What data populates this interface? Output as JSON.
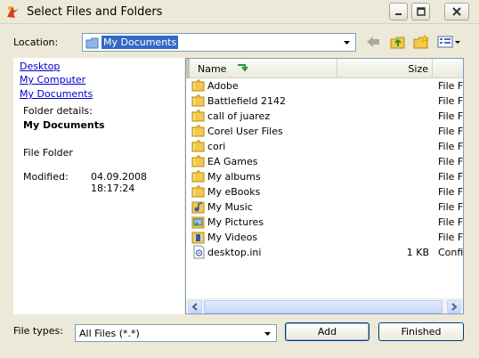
{
  "window": {
    "title": "Select Files and Folders"
  },
  "location": {
    "label": "Location:",
    "value": "My Documents"
  },
  "left_panel": {
    "links": [
      "Desktop",
      "My Computer",
      "My Documents"
    ],
    "details_heading": "Folder details:",
    "folder_name": "My Documents",
    "folder_type": "File Folder",
    "modified_label": "Modified:",
    "modified_date": "04.09.2008",
    "modified_time": "18:17:24"
  },
  "file_list": {
    "columns": {
      "name": "Name",
      "size": "Size"
    },
    "rows": [
      {
        "name": "Adobe",
        "size": "",
        "type": "File Folder",
        "icon": "folder"
      },
      {
        "name": "Battlefield 2142",
        "size": "",
        "type": "File Folder",
        "icon": "folder"
      },
      {
        "name": "call of juarez",
        "size": "",
        "type": "File Folder",
        "icon": "folder"
      },
      {
        "name": "Corel User Files",
        "size": "",
        "type": "File Folder",
        "icon": "folder"
      },
      {
        "name": "cori",
        "size": "",
        "type": "File Folder",
        "icon": "folder"
      },
      {
        "name": "EA Games",
        "size": "",
        "type": "File Folder",
        "icon": "folder"
      },
      {
        "name": "My albums",
        "size": "",
        "type": "File Folder",
        "icon": "folder"
      },
      {
        "name": "My eBooks",
        "size": "",
        "type": "File Folder",
        "icon": "folder"
      },
      {
        "name": "My Music",
        "size": "",
        "type": "File Folder",
        "icon": "music-folder"
      },
      {
        "name": "My Pictures",
        "size": "",
        "type": "File Folder",
        "icon": "pictures-folder"
      },
      {
        "name": "My Videos",
        "size": "",
        "type": "File Folder",
        "icon": "videos-folder"
      },
      {
        "name": "desktop.ini",
        "size": "1 KB",
        "type": "Configuration",
        "icon": "ini-file"
      }
    ]
  },
  "bottom": {
    "file_types_label": "File types:",
    "file_types_value": "All Files (*.*)",
    "add_label": "Add",
    "finished_label": "Finished"
  },
  "colors": {
    "window_bg": "#ece9d8",
    "selection": "#316ac5",
    "link": "#0000cc",
    "folder": "#f2c94c"
  }
}
